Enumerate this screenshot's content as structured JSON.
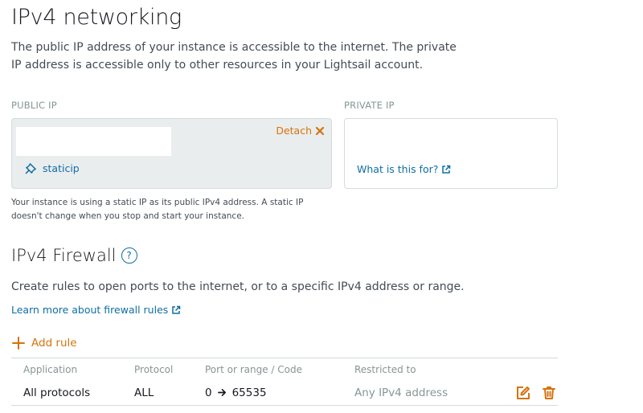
{
  "section": {
    "title": "IPv4 networking",
    "description": "The public IP address of your instance is accessible to the internet. The private IP address is accessible only to other resources in your Lightsail account."
  },
  "public_ip": {
    "label": "PUBLIC IP",
    "detach_label": "Detach",
    "static_ip_name": "staticip",
    "note": "Your instance is using a static IP as its public IPv4 address. A static IP doesn't change when you stop and start your instance."
  },
  "private_ip": {
    "label": "PRIVATE IP",
    "help_link": "What is this for?"
  },
  "firewall": {
    "title": "IPv4 Firewall",
    "help_glyph": "?",
    "description": "Create rules to open ports to the internet, or to a specific IPv4 address or range.",
    "learn_more": "Learn more about firewall rules",
    "add_rule": "Add rule",
    "columns": [
      "Application",
      "Protocol",
      "Port or range / Code",
      "Restricted to"
    ],
    "rows": [
      {
        "application": "All protocols",
        "protocol": "ALL",
        "port_from": "0",
        "port_to": "65535",
        "restricted_to": "Any IPv4 address"
      }
    ]
  },
  "colors": {
    "accent_orange": "#d5730c",
    "link_blue": "#0f6ea5",
    "muted_gray": "#879596"
  },
  "icons": [
    "close-x-icon",
    "pin-icon",
    "external-link-icon",
    "help-circle-icon",
    "plus-icon",
    "arrow-right-icon",
    "edit-icon",
    "trash-icon"
  ]
}
